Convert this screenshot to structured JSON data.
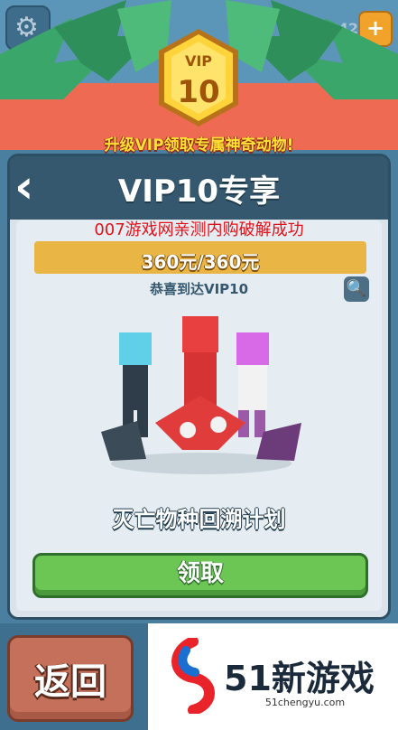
{
  "hud": {
    "score": "442",
    "plus_label": "+",
    "gear_glyph": "⚙"
  },
  "badge": {
    "vip_label": "VIP",
    "level": "10"
  },
  "header": {
    "subtitle": "升级VIP领取专属神奇动物!"
  },
  "panel": {
    "back_glyph": "‹",
    "title": "VIP10专享",
    "watermark": "007游戏网亲测内购破解成功",
    "price": "360元/360元",
    "congrats": "恭喜到达VIP10",
    "search_glyph": "🔍",
    "reward_name": "灭亡物种回溯计划",
    "claim_label": "领取"
  },
  "footer": {
    "return_label": "返回",
    "logo_main": "51新游戏",
    "logo_sub": "51chengyu.com"
  },
  "colors": {
    "accent_gold": "#e9b646",
    "claim_green": "#6cc653",
    "header_coral": "#ef6a52",
    "watermark_red": "#e0121a"
  }
}
